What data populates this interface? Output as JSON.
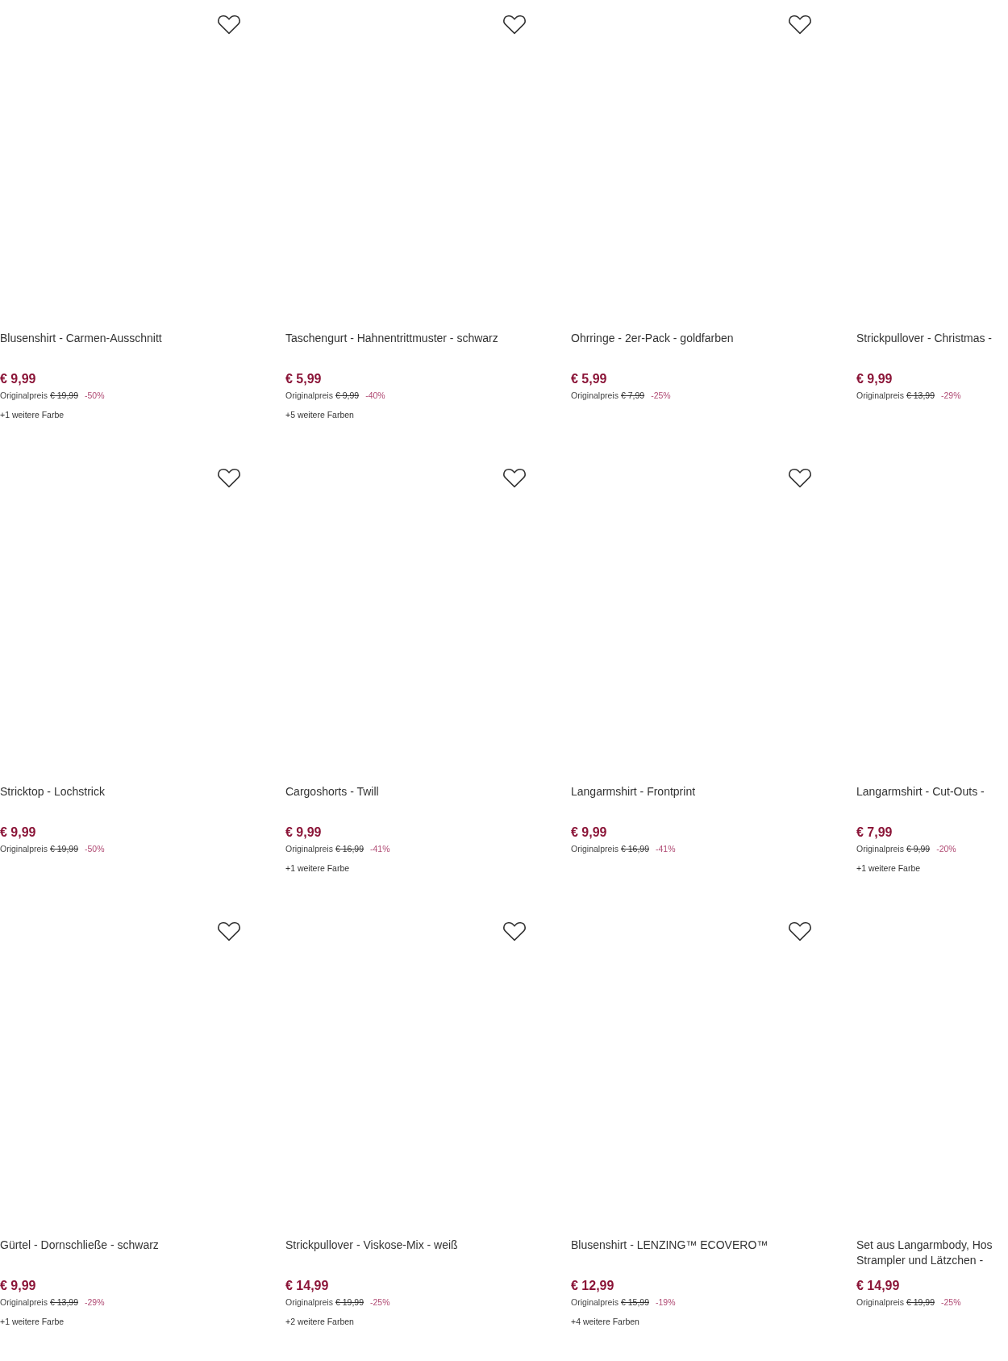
{
  "products": [
    {
      "title": "Blusenshirt - Carmen-Ausschnitt",
      "wishlist_icon": true,
      "price": "€ 9,99",
      "original_label": "Originalpreis",
      "original_price": "€ 19,99",
      "discount": "-50%",
      "more_colors": "+1 weitere Farbe"
    },
    {
      "title": "Taschengurt - Hahnentrittmuster - schwarz",
      "wishlist_icon": true,
      "price": "€ 5,99",
      "original_label": "Originalpreis",
      "original_price": "€ 9,99",
      "discount": "-40%",
      "more_colors": "+5 weitere Farben"
    },
    {
      "title": "Ohrringe - 2er-Pack - goldfarben",
      "wishlist_icon": true,
      "price": "€ 5,99",
      "original_label": "Originalpreis",
      "original_price": "€ 7,99",
      "discount": "-25%"
    },
    {
      "title": "Strickpullover - Christmas -",
      "wishlist_icon": false,
      "price": "€ 9,99",
      "original_label": "Originalpreis",
      "original_price": "€ 13,99",
      "discount": "-29%"
    },
    {
      "title": "Stricktop - Lochstrick",
      "wishlist_icon": true,
      "price": "€ 9,99",
      "original_label": "Originalpreis",
      "original_price": "€ 19,99",
      "discount": "-50%"
    },
    {
      "title": "Cargoshorts - Twill",
      "wishlist_icon": true,
      "price": "€ 9,99",
      "original_label": "Originalpreis",
      "original_price": "€ 16,99",
      "discount": "-41%",
      "more_colors": "+1 weitere Farbe"
    },
    {
      "title": "Langarmshirt - Frontprint",
      "wishlist_icon": true,
      "price": "€ 9,99",
      "original_label": "Originalpreis",
      "original_price": "€ 16,99",
      "discount": "-41%"
    },
    {
      "title": "Langarmshirt - Cut-Outs -",
      "wishlist_icon": false,
      "price": "€ 7,99",
      "original_label": "Originalpreis",
      "original_price": "€ 9,99",
      "discount": "-20%",
      "more_colors": "+1 weitere Farbe"
    },
    {
      "title": "Gürtel - Dornschließe - schwarz",
      "wishlist_icon": true,
      "price": "€ 9,99",
      "original_label": "Originalpreis",
      "original_price": "€ 13,99",
      "discount": "-29%",
      "more_colors": "+1 weitere Farbe"
    },
    {
      "title": "Strickpullover - Viskose-Mix - weiß",
      "wishlist_icon": true,
      "price": "€ 14,99",
      "original_label": "Originalpreis",
      "original_price": "€ 19,99",
      "discount": "-25%",
      "more_colors": "+2 weitere Farben"
    },
    {
      "title": "Blusenshirt - LENZING™ ECOVERO™",
      "wishlist_icon": true,
      "price": "€ 12,99",
      "original_label": "Originalpreis",
      "original_price": "€ 15,99",
      "discount": "-19%",
      "more_colors": "+4 weitere Farben"
    },
    {
      "title": "Set aus Langarmbody, Hos\nStrampler und Lätzchen -",
      "wishlist_icon": false,
      "price": "€ 14,99",
      "original_label": "Originalpreis",
      "original_price": "€ 19,99",
      "discount": "-25%"
    }
  ]
}
